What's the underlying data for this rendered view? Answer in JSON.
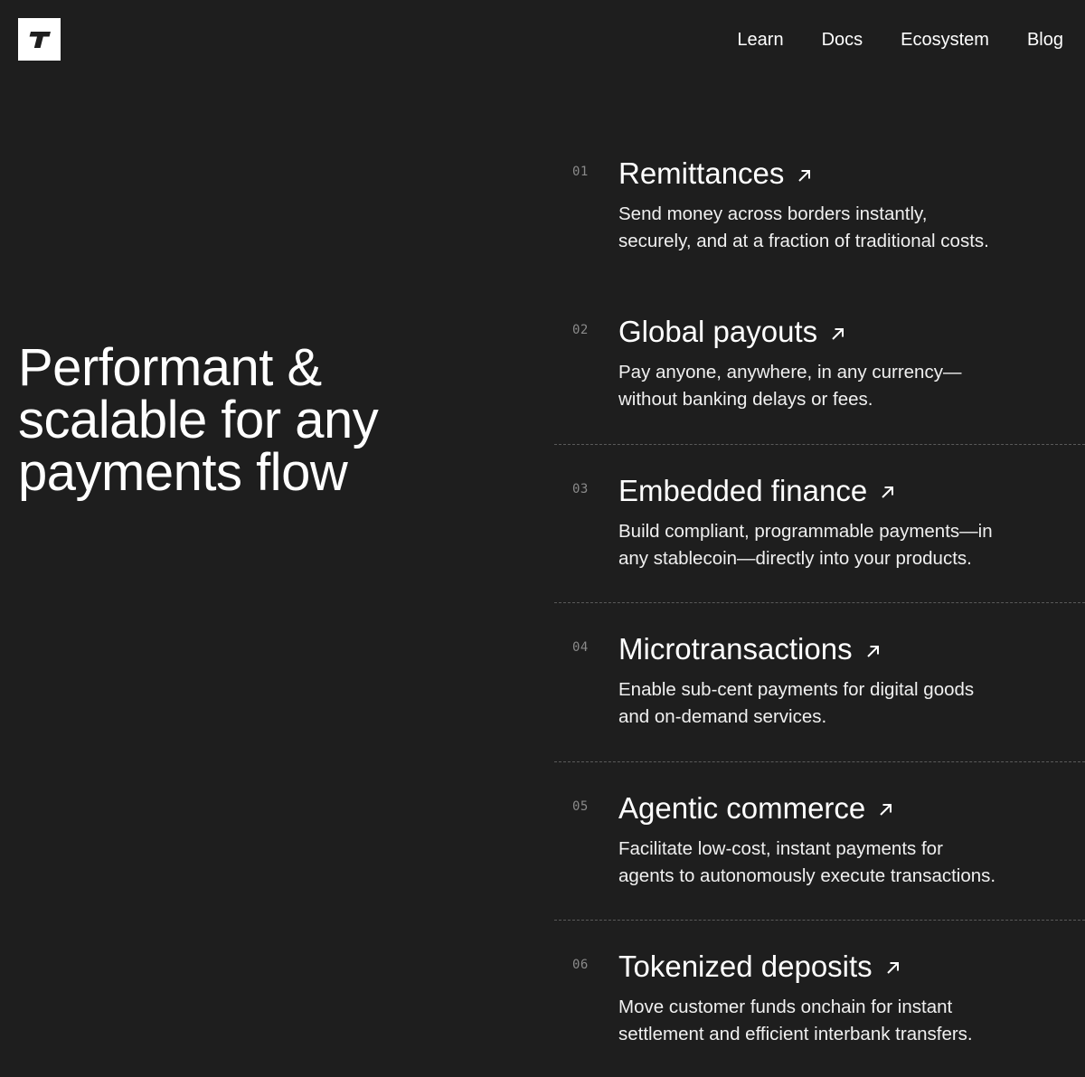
{
  "header": {
    "logo_icon": "t-letter-logo-icon",
    "nav": [
      "Learn",
      "Docs",
      "Ecosystem",
      "Blog"
    ]
  },
  "hero": {
    "title_lines": [
      "Performant &",
      "scalable for any",
      "payments flow"
    ]
  },
  "use_cases": [
    {
      "number": "01",
      "title": "Remittances",
      "icon": "arrow-up-right-icon",
      "desc_lines": [
        "Send money across borders instantly,",
        "securely, and at a fraction of traditional costs."
      ]
    },
    {
      "number": "02",
      "title": "Global payouts",
      "icon": "arrow-up-right-icon",
      "desc_lines": [
        "Pay anyone, anywhere, in any currency—",
        "without banking delays or fees."
      ]
    },
    {
      "number": "03",
      "title": "Embedded finance",
      "icon": "arrow-up-right-icon",
      "desc_lines": [
        "Build compliant, programmable payments—in",
        "any stablecoin—directly into your products."
      ]
    },
    {
      "number": "04",
      "title": "Microtransactions",
      "icon": "arrow-up-right-icon",
      "desc_lines": [
        "Enable sub-cent payments for digital goods",
        "and on-demand services."
      ]
    },
    {
      "number": "05",
      "title": "Agentic commerce",
      "icon": "arrow-up-right-icon",
      "desc_lines": [
        "Facilitate low-cost, instant payments for",
        "agents to autonomously execute transactions."
      ]
    },
    {
      "number": "06",
      "title": "Tokenized deposits",
      "icon": "arrow-up-right-icon",
      "desc_lines": [
        "Move customer funds onchain for instant",
        "settlement and efficient interbank transfers."
      ]
    }
  ],
  "colors": {
    "background": "#1e1e1e",
    "text": "#ffffff",
    "muted": "#8a8a8a",
    "divider": "#5a5a5a"
  }
}
